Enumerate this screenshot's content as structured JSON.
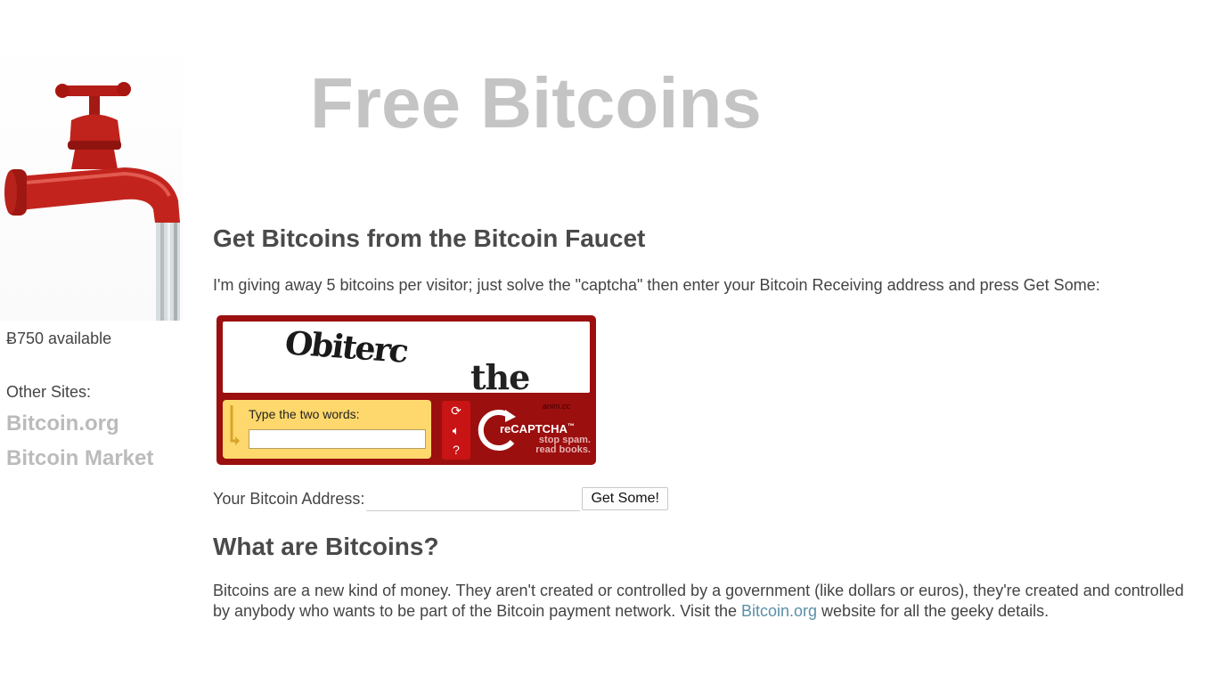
{
  "header": {
    "title": "Free Bitcoins"
  },
  "sidebar": {
    "balance": "Ƀ750 available",
    "other_sites_label": "Other Sites:",
    "links": [
      "Bitcoin.org",
      "Bitcoin Market"
    ]
  },
  "main": {
    "heading": "Get Bitcoins from the Bitcoin Faucet",
    "intro": "I'm giving away 5 bitcoins per visitor; just solve the \"captcha\" then enter your Bitcoin Receiving address and press Get Some:",
    "recaptcha": {
      "word1": "Obiterc",
      "word2": "the",
      "prompt": "Type the two words:",
      "input_value": "",
      "logo_text": "reCAPTCHA",
      "tm": "™",
      "tagline_1": "stop spam.",
      "tagline_2": "read books.",
      "small_text": "anim.cc",
      "buttons": [
        "refresh-icon",
        "audio-icon",
        "help-icon"
      ]
    },
    "address_form": {
      "label": "Your Bitcoin Address:",
      "input_value": "",
      "button_label": "Get Some!"
    },
    "what_heading": "What are Bitcoins?",
    "description_before": "Bitcoins are a new kind of money. They aren't created or controlled by a government (like dollars or euros), they're created and controlled by anybody who wants to be part of the Bitcoin payment network. Visit the ",
    "description_link": "Bitcoin.org",
    "description_after": " website for all the geeky details."
  },
  "colors": {
    "title": "#c4c4c4",
    "heading": "#4a4a4a",
    "link": "#5b8fa8",
    "recaptcha_red": "#9b0f0f",
    "recaptcha_yellow": "#fed86c",
    "faucet_red": "#c0201c"
  }
}
